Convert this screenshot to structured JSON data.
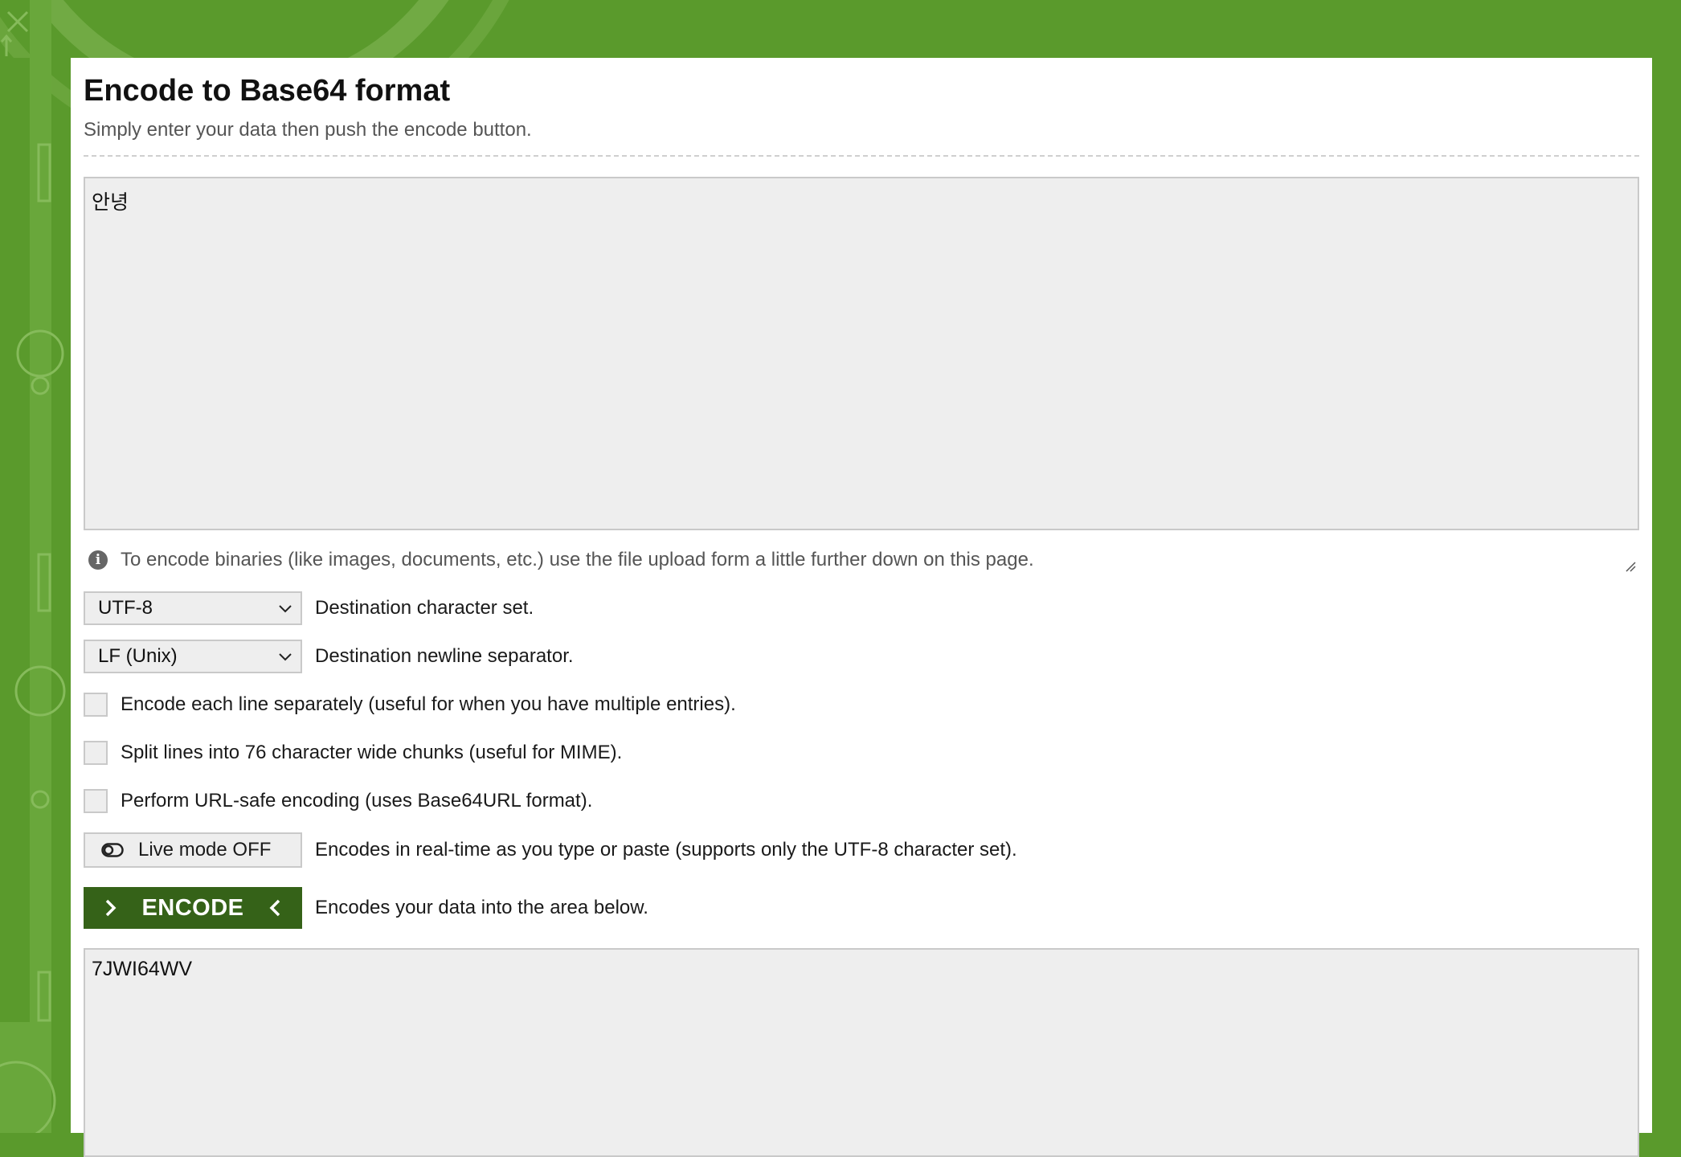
{
  "page": {
    "title": "Encode to Base64 format",
    "subtitle": "Simply enter your data then push the encode button."
  },
  "input": {
    "value": "안녕"
  },
  "info": {
    "text": "To encode binaries (like images, documents, etc.) use the file upload form a little further down on this page.",
    "icon": "info-icon"
  },
  "charset": {
    "selected": "UTF-8",
    "label": "Destination character set."
  },
  "newline": {
    "selected": "LF (Unix)",
    "label": "Destination newline separator."
  },
  "options": {
    "each_line": {
      "label": "Encode each line separately (useful for when you have multiple entries).",
      "checked": false
    },
    "split_lines": {
      "label": "Split lines into 76 character wide chunks (useful for MIME).",
      "checked": false
    },
    "url_safe": {
      "label": "Perform URL-safe encoding (uses Base64URL format).",
      "checked": false
    }
  },
  "live_mode": {
    "button_label": "Live mode OFF",
    "description": "Encodes in real-time as you type or paste (supports only the UTF-8 character set)."
  },
  "encode": {
    "button_label": "ENCODE",
    "description": "Encodes your data into the area below."
  },
  "output": {
    "value": "7JWI64WV"
  },
  "colors": {
    "background_green": "#5a9a2c",
    "button_green": "#356218",
    "field_gray": "#eeeeee"
  }
}
